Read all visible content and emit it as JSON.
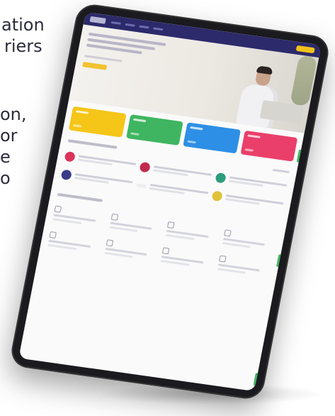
{
  "left_copy": {
    "lines": [
      "ation",
      "riers",
      "on,",
      "or",
      "e",
      "o"
    ]
  },
  "colors": {
    "header": "#2c2a6b",
    "accent_yellow": "#f5c518",
    "card_green": "#3fb561",
    "card_blue": "#2d8fe5",
    "card_pink": "#ea3f6b",
    "program_dots": [
      "#d9345c",
      "#c22a4e",
      "#2c9c7c",
      "#3a3a8a",
      "#e0c23a"
    ]
  },
  "icons": {
    "logo": "logo-icon",
    "person": "person-photo",
    "tools": [
      "document-icon",
      "chart-icon",
      "video-icon",
      "book-icon",
      "calendar-icon",
      "user-icon",
      "mail-icon",
      "settings-icon"
    ]
  }
}
